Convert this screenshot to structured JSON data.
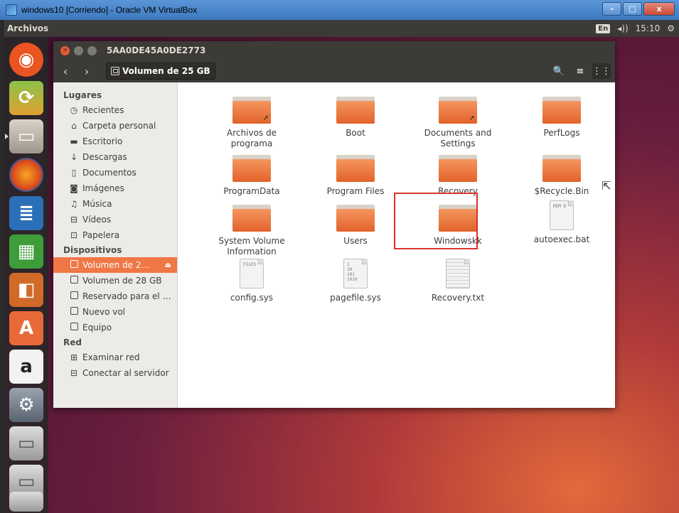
{
  "host": {
    "title": "windows10 [Corriendo] - Oracle VM VirtualBox",
    "minimize": "–",
    "maximize": "□",
    "close": "x"
  },
  "panel": {
    "app_name": "Archivos",
    "keyboard": "En",
    "volume": "◂))",
    "time": "15:10",
    "settings": "⚙"
  },
  "window": {
    "title": "5AA0DE45A0DE2773",
    "path": "Volumen de 25 GB",
    "search": "🔍",
    "list_view": "≡",
    "grid_view": "⋮⋮"
  },
  "sidebar": {
    "lugares_heading": "Lugares",
    "lugares": [
      "Recientes",
      "Carpeta personal",
      "Escritorio",
      "Descargas",
      "Documentos",
      "Imágenes",
      "Música",
      "Vídeos",
      "Papelera"
    ],
    "dispositivos_heading": "Dispositivos",
    "dispositivos": [
      "Volumen de 2…",
      "Volumen de 28 GB",
      "Reservado para el …",
      "Nuevo vol",
      "Equipo"
    ],
    "red_heading": "Red",
    "red": [
      "Examinar red",
      "Conectar al servidor"
    ]
  },
  "files": [
    {
      "name": "Archivos de programa",
      "line1": "Archivos de",
      "line2": "programa"
    },
    {
      "name": "Boot"
    },
    {
      "name": "Documents and Settings",
      "line1": "Documents and",
      "line2": "Settings"
    },
    {
      "name": "PerfLogs"
    },
    {
      "name": "ProgramData"
    },
    {
      "name": "Program Files"
    },
    {
      "name": "Recovery"
    },
    {
      "name": "$Recycle.Bin"
    },
    {
      "name": "System Volume Information",
      "line1": "System Volume",
      "line2": "Information"
    },
    {
      "name": "Users"
    },
    {
      "name": "Windowskk"
    },
    {
      "name": "autoexec.bat",
      "thumb": "REM D"
    },
    {
      "name": "config.sys",
      "thumb": "FILES"
    },
    {
      "name": "pagefile.sys",
      "thumb": "1\n10\n101\n1010"
    },
    {
      "name": "Recovery.txt"
    }
  ]
}
